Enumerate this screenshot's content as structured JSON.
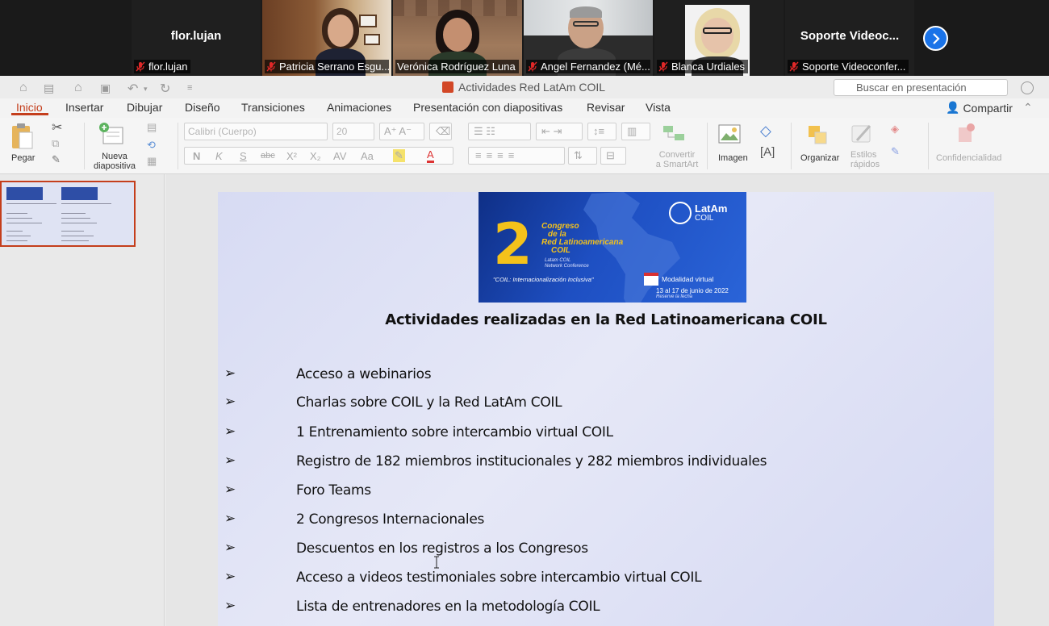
{
  "zoom": {
    "participants": [
      {
        "label": "flor.lujan",
        "display": "flor.lujan",
        "has_video": false
      },
      {
        "label": "Patricia Serrano Esgu...",
        "has_video": true
      },
      {
        "label": "Verónica Rodríguez Luna",
        "has_video": true,
        "speaking": true
      },
      {
        "label": "Angel Fernandez (Mé...",
        "has_video": true
      },
      {
        "label": "Blanca Urdiales",
        "has_video": true
      },
      {
        "label": "Soporte Videoconfer...",
        "display": "Soporte  Videoc...",
        "has_video": false
      }
    ],
    "next_icon": "chevron-right-icon"
  },
  "ppt": {
    "doc_title": "Actividades Red LatAm COIL",
    "search_placeholder": "Buscar en presentación",
    "tabs": [
      "Inicio",
      "Insertar",
      "Dibujar",
      "Diseño",
      "Transiciones",
      "Animaciones",
      "Presentación con diapositivas",
      "Revisar",
      "Vista"
    ],
    "share_label": "Compartir",
    "ribbon": {
      "paste": "Pegar",
      "new_slide_1": "Nueva",
      "new_slide_2": "diapositiva",
      "font_name": "Calibri (Cuerpo)",
      "font_size": "20",
      "convert_1": "Convertir",
      "convert_2": "a SmartArt",
      "image": "Imagen",
      "arrange": "Organizar",
      "styles_1": "Estilos",
      "styles_2": "rápidos",
      "confidentiality": "Confidencialidad"
    },
    "accent_color": "#c43e1c"
  },
  "slide": {
    "banner": {
      "number": "2",
      "title_lines": [
        "Congreso",
        "de la",
        "Red Latinoamericana",
        "COIL"
      ],
      "sub_lines": [
        "Latam COIL",
        "Network Conference"
      ],
      "quote": "\"COIL: Internacionalización Inclusiva\"",
      "logo_1": "LatAm",
      "logo_2": "COIL",
      "modality": "Modalidad virtual",
      "dates": "13 al 17 de junio de 2022",
      "reserve": "Reserve la fecha"
    },
    "title": "Actividades realizadas en la Red Latinoamericana COIL",
    "bullet_glyph": "➢",
    "bullets": [
      "Acceso a webinarios",
      "Charlas sobre COIL y la Red LatAm COIL",
      "1 Entrenamiento sobre intercambio virtual COIL",
      "Registro de 182 miembros institucionales y 282 miembros individuales",
      "Foro Teams",
      "2 Congresos Internacionales",
      "Descuentos en los registros a los Congresos",
      "Acceso a videos testimoniales sobre intercambio virtual COIL",
      "Lista de entrenadores en la metodología COIL"
    ]
  }
}
